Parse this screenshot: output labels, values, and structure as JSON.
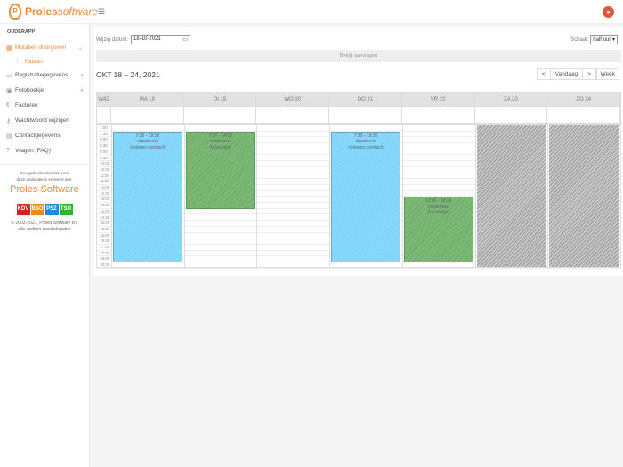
{
  "brand": {
    "name_bold": "Proles",
    "name_italic": "software"
  },
  "user": {
    "avatar_icon": "user-icon"
  },
  "sidebar": {
    "header": "OUDERAPP",
    "items": [
      {
        "label": "Mutaties doorgeven",
        "icon": "calendar-icon",
        "active": true,
        "chev": "⌄"
      },
      {
        "label": "Fabian",
        "icon": "child-icon",
        "sub": true
      },
      {
        "label": "Registratiegegevens",
        "icon": "folder-icon",
        "chev": "›"
      },
      {
        "label": "Fotoboekje",
        "icon": "image-icon",
        "chev": "›"
      },
      {
        "label": "Facturen",
        "icon": "euro-icon"
      },
      {
        "label": "Wachtwoord wijzigen",
        "icon": "key-icon"
      },
      {
        "label": "Contactgegevens",
        "icon": "contact-card-icon"
      },
      {
        "label": "Vragen (FAQ)",
        "icon": "question-icon"
      }
    ],
    "license_text1": "Een gebruikerslicentie voor",
    "license_text2": "deze applicatie is verleend aan:",
    "license_company": "Proles Software",
    "badges": [
      {
        "label": "KDV",
        "color": "#d42027"
      },
      {
        "label": "BSO",
        "color": "#f08a1c"
      },
      {
        "label": "PSZ",
        "color": "#1e88e5"
      },
      {
        "label": "TSO",
        "color": "#2db52d"
      }
    ],
    "copyright": "© 2003-2021, Proles Software BV",
    "rights": "alle rechten voorbehouden"
  },
  "toolbar": {
    "date_label": "Wijzig datum:",
    "date_value": "18-10-2021",
    "scale_label": "Schaal:",
    "scale_value": "half uur",
    "requests_button": "Bekijk aanvragen"
  },
  "calendar": {
    "title": "OKT 18 – 24, 2021",
    "prev": "<",
    "today": "Vandaag",
    "next": ">",
    "view": "Week",
    "week_label": "W42",
    "days": [
      "MA 18",
      "DI 19",
      "WO 20",
      "DO 21",
      "VR 22",
      "ZA 23",
      "ZO 24"
    ],
    "times": [
      "7:00",
      "7:30",
      "8:00",
      "8:30",
      "9:00",
      "9:30",
      "10:00",
      "10:30",
      "11:00",
      "11:30",
      "12:00",
      "12:30",
      "13:00",
      "13:30",
      "14:00",
      "14:30",
      "15:00",
      "15:30",
      "16:00",
      "16:30",
      "17:00",
      "17:30",
      "18:00",
      "18:30"
    ],
    "unavailable_days": [
      5,
      6
    ],
    "events": [
      {
        "day": 0,
        "start": 7.5,
        "end": 18.5,
        "time": "7:30 - 18:30",
        "type": "structureel",
        "note": "(volgens contract)",
        "color": "blue"
      },
      {
        "day": 1,
        "start": 7.5,
        "end": 14,
        "time": "7:30 - 14:00",
        "type": "incidenteel",
        "note": "(bevestigd)",
        "color": "green"
      },
      {
        "day": 3,
        "start": 7.5,
        "end": 18.5,
        "time": "7:30 - 18:30",
        "type": "structureel",
        "note": "(volgens contract)",
        "color": "blue"
      },
      {
        "day": 4,
        "start": 13,
        "end": 18.5,
        "time": "13:00 - 18:30",
        "type": "incidenteel",
        "note": "(bevestigd)",
        "color": "green"
      }
    ]
  }
}
